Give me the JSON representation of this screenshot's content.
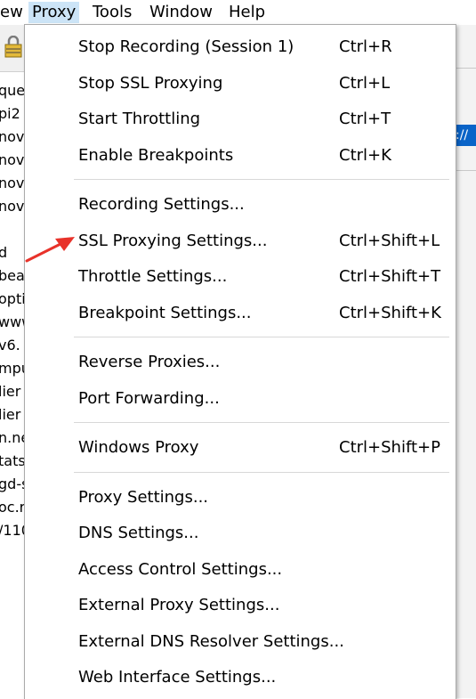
{
  "menubar": {
    "items": [
      {
        "label": "ew"
      },
      {
        "label": "Proxy"
      },
      {
        "label": "Tools"
      },
      {
        "label": "Window"
      },
      {
        "label": "Help"
      }
    ]
  },
  "background_list": [
    "que",
    "pi2",
    "nov",
    "nov",
    "nov",
    "nov",
    "",
    "d",
    "bea",
    "opti",
    "www",
    "v6.",
    "mpu",
    "lier",
    "lier",
    "n.ne",
    "tats",
    "gd-s",
    "oc.r",
    "/110"
  ],
  "right_blue_text": "://",
  "menu": {
    "groups": [
      [
        {
          "label": "Stop Recording (Session 1)",
          "shortcut": "Ctrl+R"
        },
        {
          "label": "Stop SSL Proxying",
          "shortcut": "Ctrl+L"
        },
        {
          "label": "Start Throttling",
          "shortcut": "Ctrl+T"
        },
        {
          "label": "Enable Breakpoints",
          "shortcut": "Ctrl+K"
        }
      ],
      [
        {
          "label": "Recording Settings...",
          "shortcut": ""
        },
        {
          "label": "SSL Proxying Settings...",
          "shortcut": "Ctrl+Shift+L"
        },
        {
          "label": "Throttle Settings...",
          "shortcut": "Ctrl+Shift+T"
        },
        {
          "label": "Breakpoint Settings...",
          "shortcut": "Ctrl+Shift+K"
        }
      ],
      [
        {
          "label": "Reverse Proxies...",
          "shortcut": ""
        },
        {
          "label": "Port Forwarding...",
          "shortcut": ""
        }
      ],
      [
        {
          "label": "Windows Proxy",
          "shortcut": "Ctrl+Shift+P"
        }
      ],
      [
        {
          "label": "Proxy Settings...",
          "shortcut": ""
        },
        {
          "label": "DNS Settings...",
          "shortcut": ""
        },
        {
          "label": "Access Control Settings...",
          "shortcut": ""
        },
        {
          "label": "External Proxy Settings...",
          "shortcut": ""
        },
        {
          "label": "External DNS Resolver Settings...",
          "shortcut": ""
        },
        {
          "label": "Web Interface Settings...",
          "shortcut": ""
        }
      ]
    ]
  },
  "colors": {
    "arrow": "#e8322a",
    "selection": "#0a64c8",
    "menubar_active": "#cce4f7"
  }
}
